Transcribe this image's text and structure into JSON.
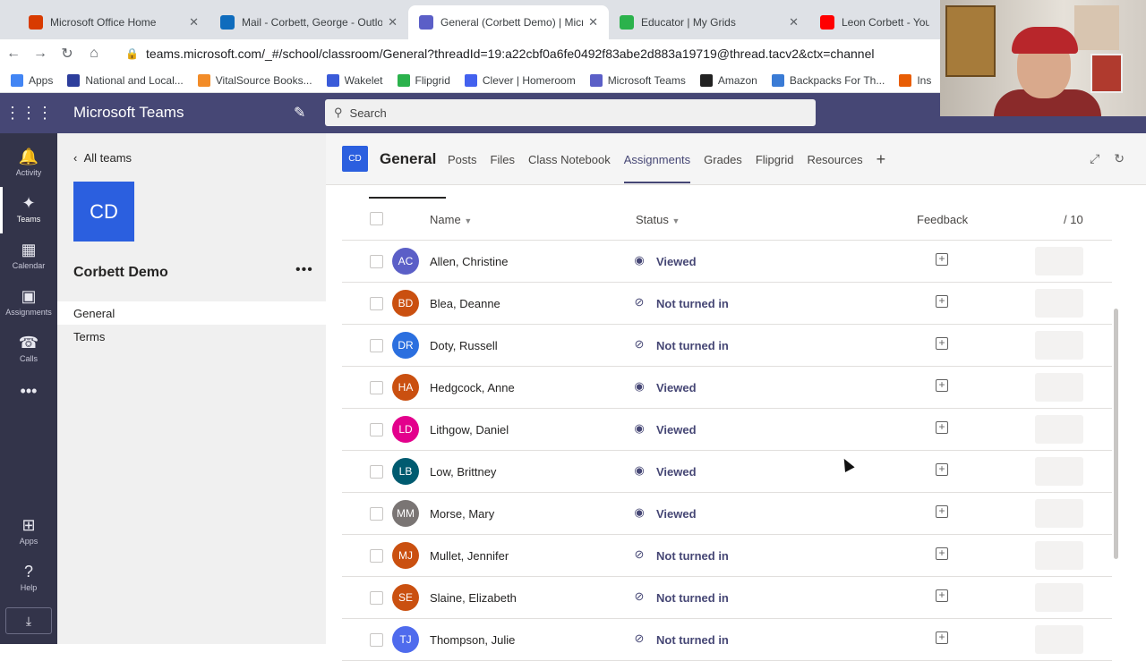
{
  "browser": {
    "tabs": [
      {
        "title": "Microsoft Office Home",
        "favicon_color": "#d83b01",
        "icon": "office-icon"
      },
      {
        "title": "Mail - Corbett, George - Outlook",
        "favicon_color": "#0f6cbd",
        "icon": "outlook-icon"
      },
      {
        "title": "General (Corbett Demo) | Microsoft Teams",
        "favicon_color": "#5b5fc7",
        "icon": "teams-icon"
      },
      {
        "title": "Educator | My Grids",
        "favicon_color": "#2bb24c",
        "icon": "flipgrid-icon"
      },
      {
        "title": "Leon Corbett - YouTube",
        "favicon_color": "#ff0000",
        "icon": "youtube-icon"
      }
    ],
    "url": "teams.microsoft.com/_#/school/classroom/General?threadId=19:a22cbf0a6fe0492f83abe2d883a19719@thread.tacv2&ctx=channel",
    "bookmarks": [
      {
        "label": "Apps",
        "color": "#4285f4"
      },
      {
        "label": "National and Local...",
        "color": "#2d3e9c"
      },
      {
        "label": "VitalSource Books...",
        "color": "#f28c28"
      },
      {
        "label": "Wakelet",
        "color": "#3a5bd9"
      },
      {
        "label": "Flipgrid",
        "color": "#2bb24c"
      },
      {
        "label": "Clever | Homeroom",
        "color": "#4361ee"
      },
      {
        "label": "Microsoft Teams",
        "color": "#5b5fc7"
      },
      {
        "label": "Amazon",
        "color": "#222222"
      },
      {
        "label": "Backpacks For Th...",
        "color": "#3a7bd5"
      },
      {
        "label": "Ins",
        "color": "#e85d04"
      }
    ]
  },
  "teams": {
    "app_name": "Microsoft Teams",
    "search_placeholder": "Search",
    "rail": [
      {
        "label": "Activity",
        "icon": "bell-icon"
      },
      {
        "label": "Teams",
        "icon": "teams-icon"
      },
      {
        "label": "Calendar",
        "icon": "calendar-icon"
      },
      {
        "label": "Assignments",
        "icon": "assignments-icon"
      },
      {
        "label": "Calls",
        "icon": "phone-icon"
      },
      {
        "label": "",
        "icon": "more-icon"
      },
      {
        "label": "Apps",
        "icon": "apps-icon"
      },
      {
        "label": "Help",
        "icon": "help-icon"
      }
    ]
  },
  "team_panel": {
    "back_label": "All teams",
    "tile_initials": "CD",
    "team_name": "Corbett Demo",
    "channels": [
      "General",
      "Terms"
    ]
  },
  "channel": {
    "tile_initials": "CD",
    "name": "General",
    "tabs": [
      "Posts",
      "Files",
      "Class Notebook",
      "Assignments",
      "Grades",
      "Flipgrid",
      "Resources"
    ],
    "active_tab": "Assignments"
  },
  "table": {
    "headers": {
      "name": "Name",
      "status": "Status",
      "feedback": "Feedback",
      "points": "/ 10"
    },
    "rows": [
      {
        "initials": "AC",
        "name": "Allen, Christine",
        "status": "Viewed",
        "status_icon": "eye-icon",
        "color": "#5b5fc7"
      },
      {
        "initials": "BD",
        "name": "Blea, Deanne",
        "status": "Not turned in",
        "status_icon": "blocked-icon",
        "color": "#ca5010"
      },
      {
        "initials": "DR",
        "name": "Doty, Russell",
        "status": "Not turned in",
        "status_icon": "blocked-icon",
        "color": "#2b6fdf"
      },
      {
        "initials": "HA",
        "name": "Hedgcock, Anne",
        "status": "Viewed",
        "status_icon": "eye-icon",
        "color": "#ca5010"
      },
      {
        "initials": "LD",
        "name": "Lithgow, Daniel",
        "status": "Viewed",
        "status_icon": "eye-icon",
        "color": "#e3008c"
      },
      {
        "initials": "LB",
        "name": "Low, Brittney",
        "status": "Viewed",
        "status_icon": "eye-icon",
        "color": "#005b70"
      },
      {
        "initials": "MM",
        "name": "Morse, Mary",
        "status": "Viewed",
        "status_icon": "eye-icon",
        "color": "#7a7574"
      },
      {
        "initials": "MJ",
        "name": "Mullet, Jennifer",
        "status": "Not turned in",
        "status_icon": "blocked-icon",
        "color": "#ca5010"
      },
      {
        "initials": "SE",
        "name": "Slaine, Elizabeth",
        "status": "Not turned in",
        "status_icon": "blocked-icon",
        "color": "#ca5010"
      },
      {
        "initials": "TJ",
        "name": "Thompson, Julie",
        "status": "Not turned in",
        "status_icon": "blocked-icon",
        "color": "#4f6bed"
      }
    ]
  },
  "colors": {
    "brand": "#464775",
    "rail": "#33344a",
    "accent_tile": "#2b5fdf"
  }
}
